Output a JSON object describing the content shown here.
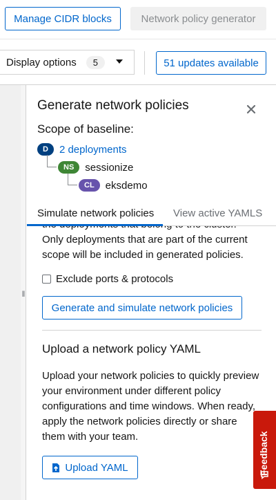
{
  "toolbar": {
    "manage_cidr_label": "Manage CIDR blocks",
    "network_policy_generator_label": "Network policy generator",
    "display_options_label": "Display options",
    "display_options_count": "5",
    "updates_label": "51 updates available"
  },
  "panel": {
    "title": "Generate network policies",
    "scope_title": "Scope of baseline:",
    "scope": [
      {
        "badge": "D",
        "badge_color": "#004080",
        "label": "2 deployments",
        "link": true
      },
      {
        "badge": "NS",
        "badge_color": "#3e8635",
        "label": "sessionize",
        "link": false
      },
      {
        "badge": "CL",
        "badge_color": "#6753ac",
        "label": "eksdemo",
        "link": false
      }
    ],
    "tabs": [
      {
        "label": "Simulate network policies",
        "active": true
      },
      {
        "label": "View active YAMLS",
        "active": false
      }
    ],
    "clipped_text": "the deployments that belong to the cluster.",
    "scope_note_line1": "Only deployments that are part of the current",
    "scope_note_line2": "scope will be included in generated policies.",
    "exclude_ports_label": "Exclude ports & protocols",
    "generate_button_label": "Generate and simulate network policies",
    "upload_section_title": "Upload a network policy YAML",
    "upload_desc_lines": [
      "Upload your network policies to quickly preview",
      "your environment under different policy",
      "configurations and time windows. When ready,",
      "apply the network policies directly or share",
      "them with your team."
    ],
    "upload_button_label": "Upload YAML"
  },
  "feedback_label": "Feedback",
  "colors": {
    "accent": "#0066cc",
    "feedback": "#c9190b"
  }
}
